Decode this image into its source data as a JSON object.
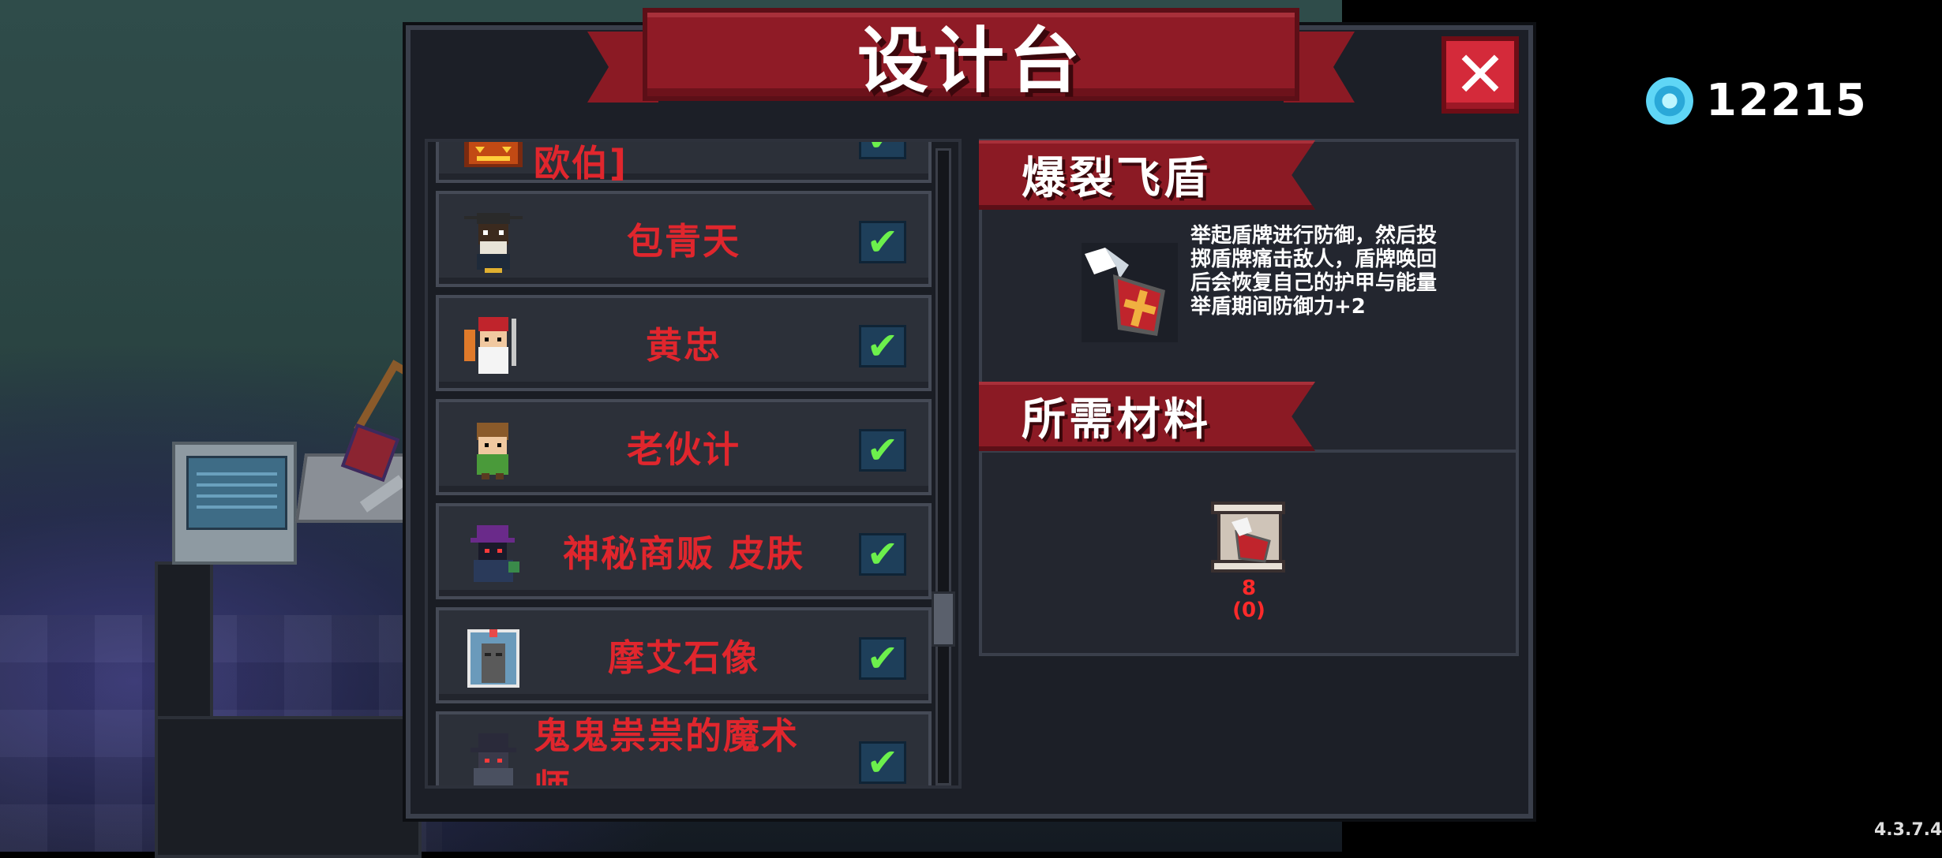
{
  "title": "设计台",
  "currency": {
    "icon": "blue-gem-icon",
    "amount": "12215"
  },
  "list": {
    "items": [
      {
        "label": "技能书[防刀·艾利欧伯]",
        "icon": "pumpkin-icon",
        "checked": true
      },
      {
        "label": "包青天",
        "icon": "bao-qingtian-icon",
        "checked": true
      },
      {
        "label": "黄忠",
        "icon": "huang-zhong-icon",
        "checked": true
      },
      {
        "label": "老伙计",
        "icon": "old-buddy-icon",
        "checked": true
      },
      {
        "label": "神秘商贩 皮肤",
        "icon": "mystery-merchant-icon",
        "checked": true
      },
      {
        "label": "摩艾石像",
        "icon": "moai-icon",
        "checked": true
      },
      {
        "label": "鬼鬼祟祟的魔术师",
        "icon": "magician-icon",
        "checked": true
      }
    ]
  },
  "detail": {
    "name": "爆裂飞盾",
    "description": [
      "举起盾牌进行防御，然后投",
      "掷盾牌痛击敌人，盾牌唤回",
      "后会恢复自己的护甲与能量",
      "举盾期间防御力+2"
    ],
    "materials_title": "所需材料",
    "material": {
      "icon": "blueprint-scroll-icon",
      "required": "8",
      "owned": "(0)"
    }
  },
  "version": "4.3.7.4",
  "colors": {
    "accent_red": "#8f1b26",
    "label_red": "#e0262d",
    "check_green": "#6cf04c"
  }
}
